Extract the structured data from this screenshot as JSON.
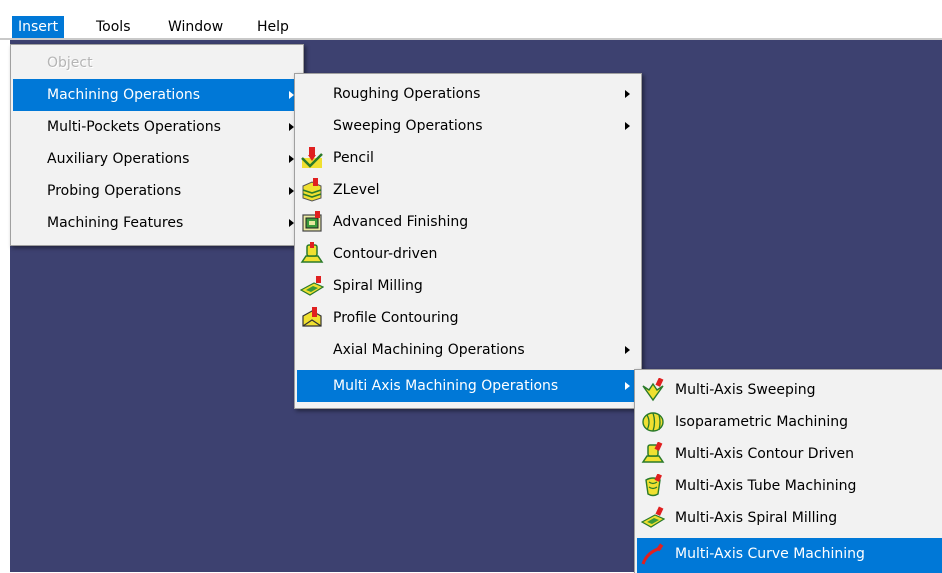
{
  "menubar": {
    "items": [
      {
        "label": "Insert"
      },
      {
        "label": "Tools"
      },
      {
        "label": "Window"
      },
      {
        "label": "Help"
      }
    ]
  },
  "insert_menu": {
    "items": [
      {
        "label": "Object",
        "state": "disabled"
      },
      {
        "label": "Machining Operations",
        "state": "highlighted",
        "submenu": true
      },
      {
        "label": "Multi-Pockets Operations",
        "submenu": true
      },
      {
        "label": "Auxiliary Operations",
        "submenu": true
      },
      {
        "label": "Probing Operations",
        "submenu": true
      },
      {
        "label": "Machining Features",
        "submenu": true
      }
    ]
  },
  "machining_menu": {
    "items": [
      {
        "label": "Roughing Operations",
        "submenu": true
      },
      {
        "label": "Sweeping Operations",
        "submenu": true
      },
      {
        "label": "Pencil",
        "icon": "pencil-icon"
      },
      {
        "label": "ZLevel",
        "icon": "zlevel-icon"
      },
      {
        "label": "Advanced Finishing",
        "icon": "advanced-finishing-icon"
      },
      {
        "label": "Contour-driven",
        "icon": "contour-driven-icon"
      },
      {
        "label": "Spiral Milling",
        "icon": "spiral-milling-icon"
      },
      {
        "label": "Profile Contouring",
        "icon": "profile-contouring-icon"
      },
      {
        "label": "Axial Machining Operations",
        "submenu": true
      },
      {
        "label": "Multi Axis Machining Operations",
        "state": "highlighted",
        "submenu": true
      }
    ]
  },
  "multiaxis_menu": {
    "items": [
      {
        "label": "Multi-Axis Sweeping",
        "icon": "multi-axis-sweeping-icon"
      },
      {
        "label": "Isoparametric Machining",
        "icon": "isoparametric-machining-icon"
      },
      {
        "label": "Multi-Axis Contour Driven",
        "icon": "multi-axis-contour-driven-icon"
      },
      {
        "label": "Multi-Axis Tube Machining",
        "icon": "multi-axis-tube-machining-icon"
      },
      {
        "label": "Multi-Axis Spiral Milling",
        "icon": "multi-axis-spiral-milling-icon"
      },
      {
        "label": "Multi-Axis Curve Machining",
        "icon": "multi-axis-curve-machining-icon",
        "state": "highlighted"
      }
    ]
  },
  "colors": {
    "menu_highlight": "#0078d7",
    "menu_background": "#f2f2f2",
    "viewport_background": "#3d4170"
  }
}
